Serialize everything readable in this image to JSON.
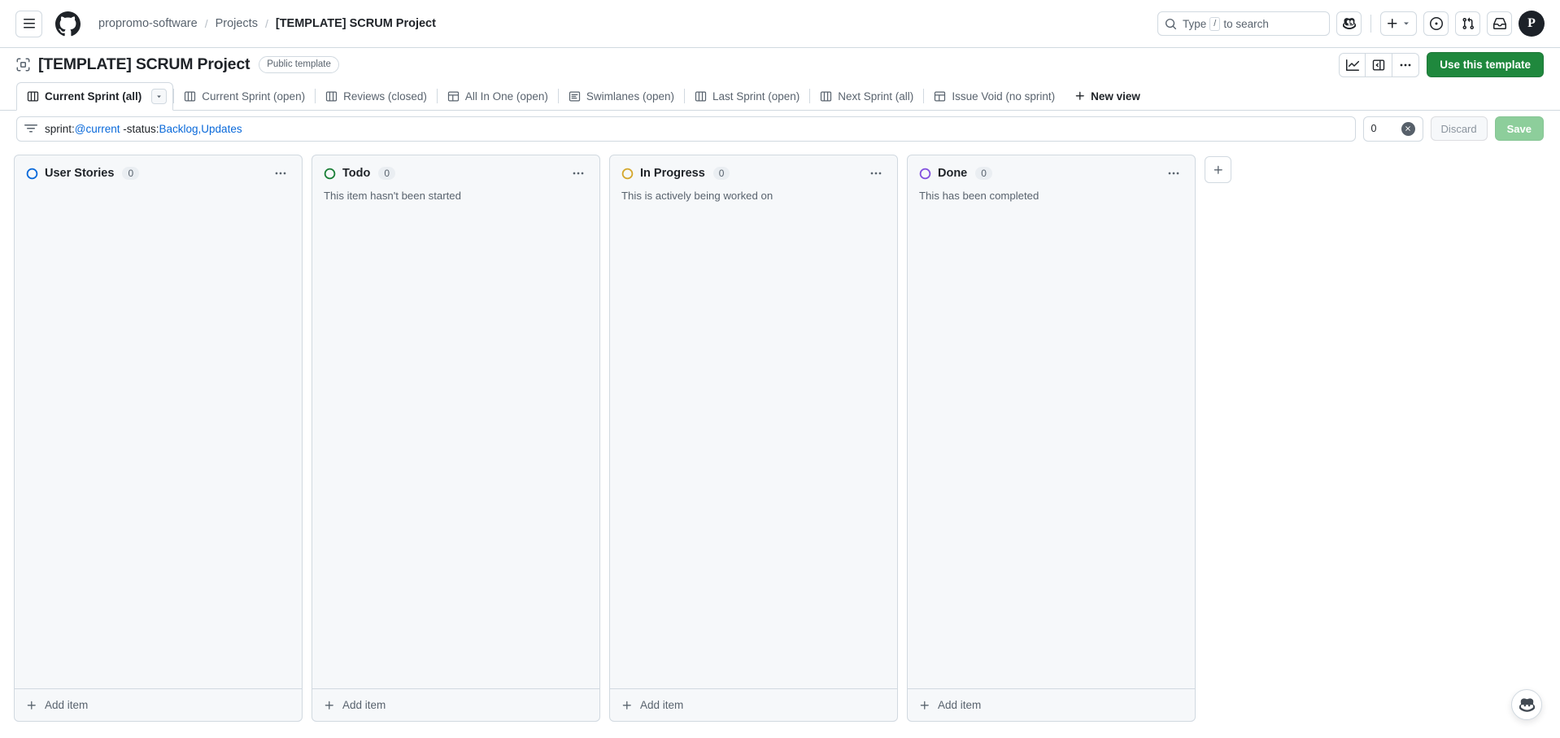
{
  "header": {
    "hamburger_icon": "hamburger-menu-icon",
    "logo_icon": "github-logo-icon",
    "breadcrumb": {
      "owner": "propromo-software",
      "section": "Projects",
      "current": "[TEMPLATE] SCRUM Project",
      "separator": "/"
    },
    "search": {
      "placeholder_prefix": "Type",
      "key_hint": "/",
      "placeholder_suffix": "to search",
      "icon": "search-icon"
    },
    "actions": [
      {
        "name": "copilot-button",
        "icon": "copilot-icon"
      },
      {
        "name": "create-new-button",
        "icon": "plus-icon"
      },
      {
        "name": "issues-button",
        "icon": "issue-opened-icon"
      },
      {
        "name": "pull-requests-button",
        "icon": "git-pull-request-icon"
      },
      {
        "name": "inbox-button",
        "icon": "inbox-icon"
      }
    ],
    "avatar_initial": "P"
  },
  "project": {
    "icon": "project-template-icon",
    "title": "[TEMPLATE] SCRUM Project",
    "badge": "Public template",
    "actions": {
      "insights_icon": "graph-line-icon",
      "panel_icon": "side-panel-icon",
      "more_icon": "kebab-horizontal-icon",
      "use_template_label": "Use this template"
    }
  },
  "tabs": {
    "items": [
      {
        "label": "Current Sprint (all)",
        "icon": "board-view-icon",
        "active": true
      },
      {
        "label": "Current Sprint (open)",
        "icon": "board-view-icon",
        "active": false
      },
      {
        "label": "Reviews (closed)",
        "icon": "board-view-icon",
        "active": false
      },
      {
        "label": "All In One (open)",
        "icon": "table-view-icon",
        "active": false
      },
      {
        "label": "Swimlanes (open)",
        "icon": "roadmap-view-icon",
        "active": false
      },
      {
        "label": "Last Sprint (open)",
        "icon": "board-view-icon",
        "active": false
      },
      {
        "label": "Next Sprint (all)",
        "icon": "board-view-icon",
        "active": false
      },
      {
        "label": "Issue Void (no sprint)",
        "icon": "table-view-icon",
        "active": false
      }
    ],
    "active_caret_icon": "triangle-down-icon",
    "new_view_label": "New view",
    "new_view_icon": "plus-icon"
  },
  "filter": {
    "icon": "filter-icon",
    "query_parts": [
      {
        "text": "sprint:",
        "highlight": false
      },
      {
        "text": "@current",
        "highlight": true
      },
      {
        "text": " -status:",
        "highlight": false
      },
      {
        "text": "Backlog,Updates",
        "highlight": true
      }
    ],
    "query_full": "sprint:@current -status:Backlog,Updates",
    "count": "0",
    "clear_icon": "x-circle-fill-icon",
    "discard_label": "Discard",
    "save_label": "Save"
  },
  "board": {
    "add_column_icon": "plus-icon",
    "add_item_label": "Add item",
    "add_item_icon": "plus-icon",
    "column_menu_icon": "kebab-horizontal-icon",
    "columns": [
      {
        "name": "User Stories",
        "count": "0",
        "description": "",
        "dot_color": "#0969da"
      },
      {
        "name": "Todo",
        "count": "0",
        "description": "This item hasn't been started",
        "dot_color": "#1a7f37"
      },
      {
        "name": "In Progress",
        "count": "0",
        "description": "This is actively being worked on",
        "dot_color": "#d4a72c"
      },
      {
        "name": "Done",
        "count": "0",
        "description": "This has been completed",
        "dot_color": "#8250df"
      }
    ]
  },
  "copilot_fab": {
    "icon": "copilot-icon"
  },
  "colors": {
    "accent": "#0969da",
    "success": "#1f883d",
    "border": "#d1d9e0",
    "canvas_subtle": "#f6f8fa",
    "fg_muted": "#59636e"
  }
}
